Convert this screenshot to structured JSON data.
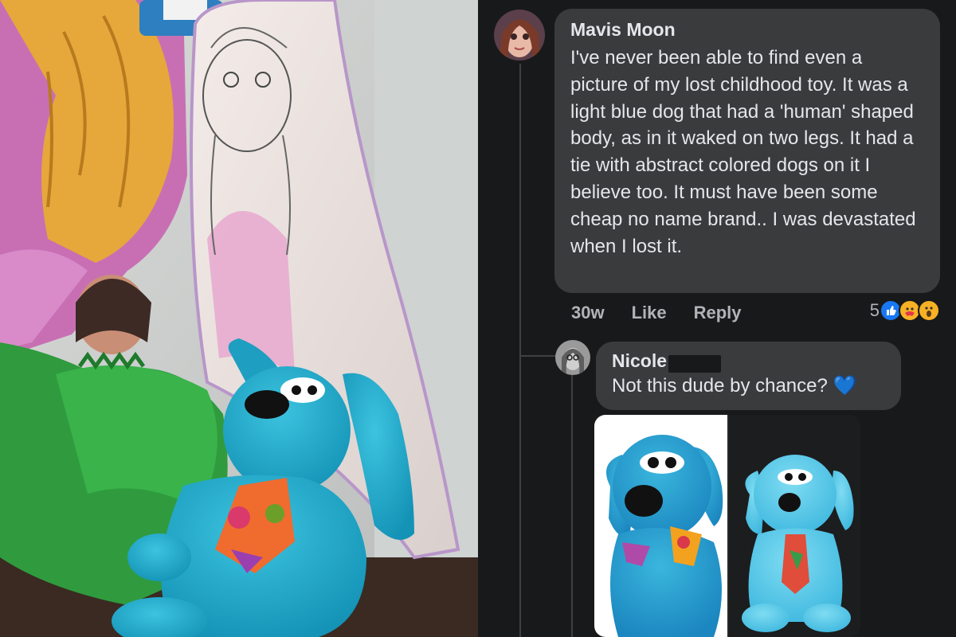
{
  "post": {
    "comment": {
      "author": "Mavis Moon",
      "text": "I've never been able to find even a picture of my lost childhood toy. It was a light blue dog that had a 'human' shaped body, as in it waked on two legs. It had a tie with abstract colored dogs on it I believe too. It must have been some cheap no name brand.. I was devastated when I lost it.",
      "time": "30w",
      "like_label": "Like",
      "reply_label": "Reply",
      "reaction_count": "5",
      "reaction_icons": [
        "like-icon",
        "care-icon",
        "wow-icon"
      ]
    },
    "reply": {
      "author": "Nicole",
      "text": "Not this dude by chance? 💙"
    }
  },
  "colors": {
    "panel_bg": "#18191a",
    "bubble_bg": "#3a3b3c",
    "text": "#e4e6eb",
    "muted": "#b0b3b8",
    "like_blue": "#1877f2"
  }
}
